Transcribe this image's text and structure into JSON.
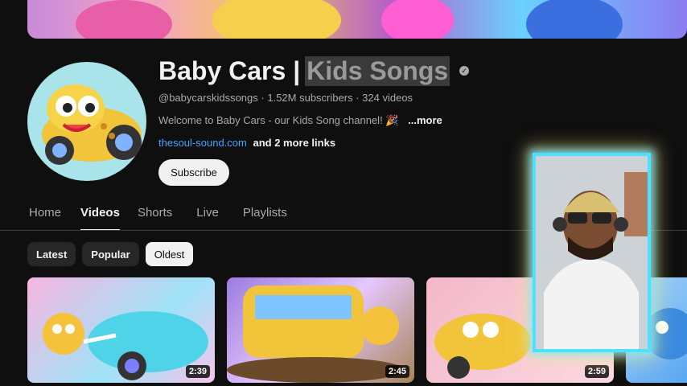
{
  "channel": {
    "title_main": "Baby Cars |",
    "title_highlight": "Kids Songs",
    "verified_glyph": "✓",
    "handle": "@babycarskidssongs",
    "subscribers": "1.52M subscribers",
    "videos": "324 videos",
    "separator": "·",
    "description": "Welcome to Baby Cars - our Kids Song channel! 🎉",
    "more_label": "...more",
    "link": "thesoul-sound.com",
    "more_links": "and 2 more links",
    "subscribe_label": "Subscribe"
  },
  "tabs": [
    {
      "label": "Home"
    },
    {
      "label": "Videos"
    },
    {
      "label": "Shorts"
    },
    {
      "label": "Live"
    },
    {
      "label": "Playlists"
    }
  ],
  "active_tab": "Videos",
  "chips": [
    {
      "label": "Latest"
    },
    {
      "label": "Popular"
    },
    {
      "label": "Oldest"
    }
  ],
  "active_chip": "Oldest",
  "videos": [
    {
      "duration": "2:39"
    },
    {
      "duration": "2:45"
    },
    {
      "duration": "2:59"
    }
  ],
  "colors": {
    "background": "#0f0f0f",
    "link": "#3ea6ff",
    "webcam_border": "#4ee0ff"
  }
}
